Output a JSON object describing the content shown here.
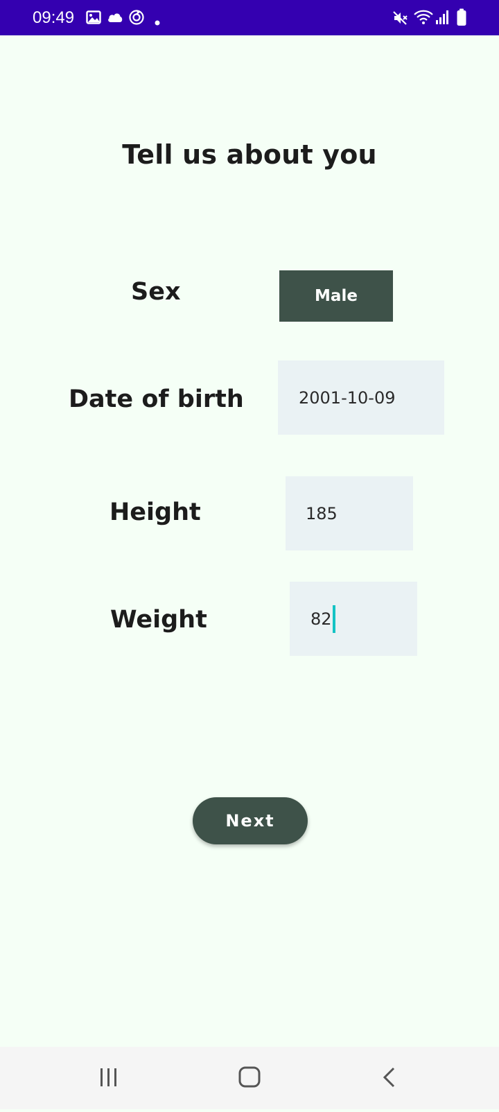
{
  "status_bar": {
    "time": "09:49",
    "background_color": "#3400b0",
    "left_icons": [
      "gallery-icon",
      "cloud-icon",
      "sync-icon",
      "dot-icon"
    ],
    "right_icons": [
      "mute-icon",
      "wifi-icon",
      "signal-icon",
      "battery-icon"
    ]
  },
  "page": {
    "title": "Tell us about you",
    "background_color": "#f5fff6"
  },
  "form": {
    "sex": {
      "label": "Sex",
      "value": "Male"
    },
    "date_of_birth": {
      "label": "Date of birth",
      "value": "2001-10-09"
    },
    "height": {
      "label": "Height",
      "value": "185"
    },
    "weight": {
      "label": "Weight",
      "value": "82"
    },
    "accent_color": "#3e5249",
    "field_background": "#eaf2f4",
    "caret_color": "#14c3c4"
  },
  "next_button": {
    "label": "Next"
  },
  "nav_bar": {
    "buttons": [
      "recent-apps-icon",
      "home-icon",
      "back-icon"
    ]
  }
}
